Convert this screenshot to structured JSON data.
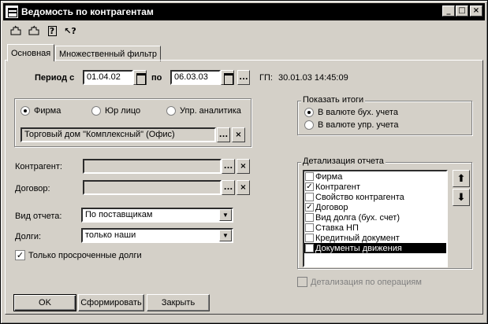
{
  "window": {
    "title": "Ведомость по контрагентам",
    "min": "_",
    "max": "□",
    "close": "×"
  },
  "toolbar": {
    "icons": [
      "open-icon",
      "save-icon",
      "help-icon",
      "whats-this-icon"
    ],
    "help_glyph": "?",
    "whats_this_glyph": "↖?"
  },
  "tabs": [
    {
      "label": "Основная"
    },
    {
      "label": "Множественный фильтр"
    }
  ],
  "period": {
    "label": "Период с",
    "from": "01.04.02",
    "to_label": "по",
    "to": "06.03.03",
    "more": "...",
    "gp_label": "ГП:",
    "gp_value": "30.01.03 14:45:09"
  },
  "entity": {
    "options": [
      "Фирма",
      "Юр лицо",
      "Упр. аналитика"
    ],
    "selected": 0,
    "value": "Торговый дом \"Комплексный\" (Офис)"
  },
  "fields": {
    "counterparty_label": "Контрагент:",
    "contract_label": "Договор:",
    "dots": "...",
    "clear": "×"
  },
  "report_type": {
    "label": "Вид отчета:",
    "value": "По поставщикам"
  },
  "debts": {
    "label": "Долги:",
    "value": "только наши"
  },
  "overdue_only": {
    "label": "Только просроченные долги",
    "checked": true,
    "mark": "✓"
  },
  "totals": {
    "title": "Показать итоги",
    "options": [
      "В валюте бух. учета",
      "В валюте упр. учета"
    ],
    "selected": 0
  },
  "detail": {
    "title": "Детализация отчета",
    "items": [
      {
        "label": "Фирма",
        "checked": false
      },
      {
        "label": "Контрагент",
        "checked": true
      },
      {
        "label": "Свойство контрагента",
        "checked": false
      },
      {
        "label": "Договор",
        "checked": true
      },
      {
        "label": "Вид долга (бух. счет)",
        "checked": false
      },
      {
        "label": "Ставка НП",
        "checked": false
      },
      {
        "label": "Кредитный документ",
        "checked": false
      },
      {
        "label": "Документы движения",
        "checked": false,
        "selected": true
      }
    ],
    "up": "⬆",
    "down": "⬇",
    "by_operations": "Детализация по операциям"
  },
  "buttons": {
    "ok": "OK",
    "generate": "Сформировать",
    "close": "Закрыть"
  }
}
